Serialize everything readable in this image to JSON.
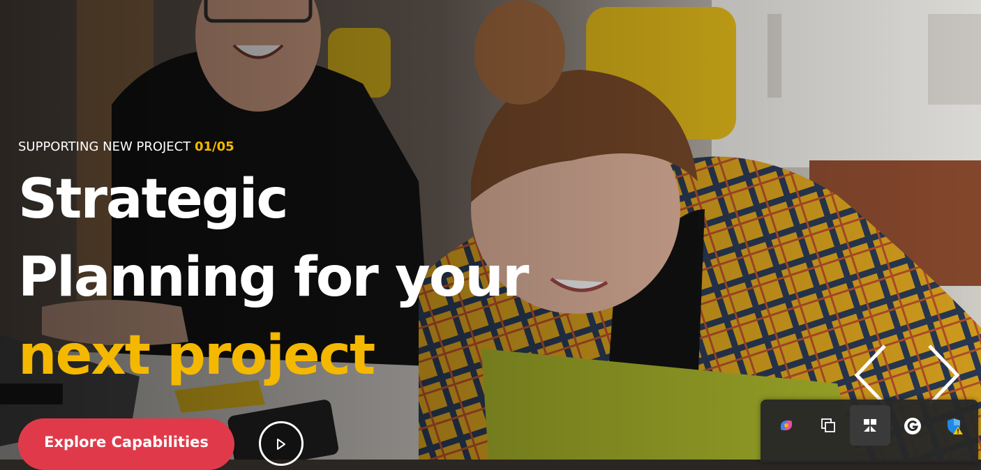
{
  "hero": {
    "eyebrow_text": "SUPPORTING NEW PROJECT",
    "slide_counter": "01/05",
    "headline_line1": "Strategic",
    "headline_line2": "Planning for your",
    "headline_line3": "next project",
    "cta_label": "Explore Capabilities"
  },
  "colors": {
    "accent_yellow": "#f5b800",
    "cta_red": "#e03a4a",
    "text_white": "#ffffff",
    "tray_background": "#282828"
  },
  "icons": {
    "play": "play-icon",
    "prev": "chevron-left-icon",
    "next": "chevron-right-icon",
    "tray": [
      "copilot-icon",
      "windows-copy-icon",
      "snipping-icon",
      "grammarly-icon",
      "windows-security-warning-icon"
    ]
  }
}
